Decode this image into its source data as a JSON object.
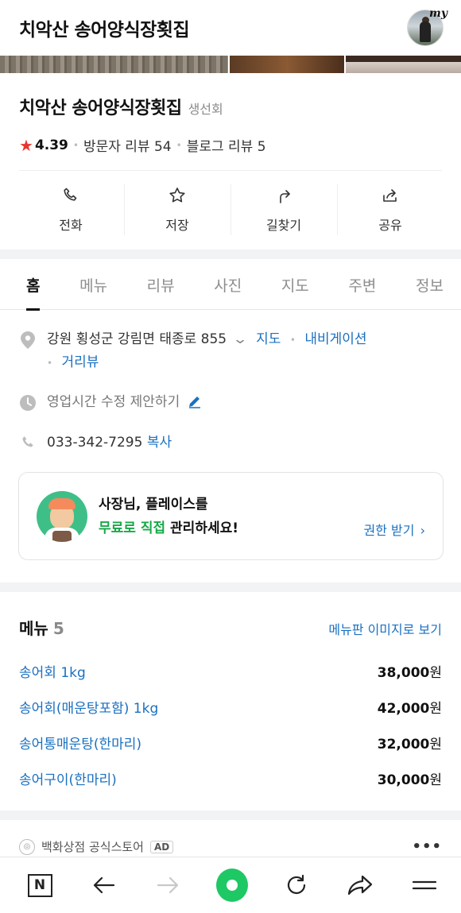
{
  "header": {
    "title": "치악산 송어양식장횟집",
    "my_label": "my"
  },
  "place": {
    "name": "치악산 송어양식장횟집",
    "category": "생선회",
    "rating": "4.39",
    "visitor_reviews": "방문자 리뷰 54",
    "blog_reviews": "블로그 리뷰 5"
  },
  "actions": [
    {
      "label": "전화",
      "icon": "phone-icon"
    },
    {
      "label": "저장",
      "icon": "star-outline-icon"
    },
    {
      "label": "길찾기",
      "icon": "directions-icon"
    },
    {
      "label": "공유",
      "icon": "share-icon"
    }
  ],
  "tabs": [
    "홈",
    "메뉴",
    "리뷰",
    "사진",
    "지도",
    "주변",
    "정보"
  ],
  "active_tab": "홈",
  "info": {
    "address": "강원 횡성군 강림면 태종로 855",
    "map_link": "지도",
    "navi_link": "내비게이션",
    "street_view": "거리뷰",
    "hours": "영업시간 수정 제안하기",
    "phone": "033-342-7295",
    "copy": "복사"
  },
  "owner_card": {
    "line1": "사장님, 플레이스를",
    "highlight": "무료로 직접",
    "line2_rest": " 관리하세요!",
    "link": "권한 받기"
  },
  "menu": {
    "title": "메뉴",
    "count": "5",
    "more_link": "메뉴판 이미지로 보기",
    "items": [
      {
        "name": "송어회 1kg",
        "price": "38,000",
        "unit": "원"
      },
      {
        "name": "송어회(매운탕포함) 1kg",
        "price": "42,000",
        "unit": "원"
      },
      {
        "name": "송어통매운탕(한마리)",
        "price": "32,000",
        "unit": "원"
      },
      {
        "name": "송어구이(한마리)",
        "price": "30,000",
        "unit": "원"
      }
    ]
  },
  "ad": {
    "label": "백화상점 공식스토어",
    "badge": "AD",
    "more": "•••"
  },
  "bottom_nav": {
    "n_label": "N"
  },
  "colors": {
    "link": "#1a70c0",
    "star": "#e8352f",
    "green": "#18a84a",
    "nav_green": "#1ec864"
  }
}
